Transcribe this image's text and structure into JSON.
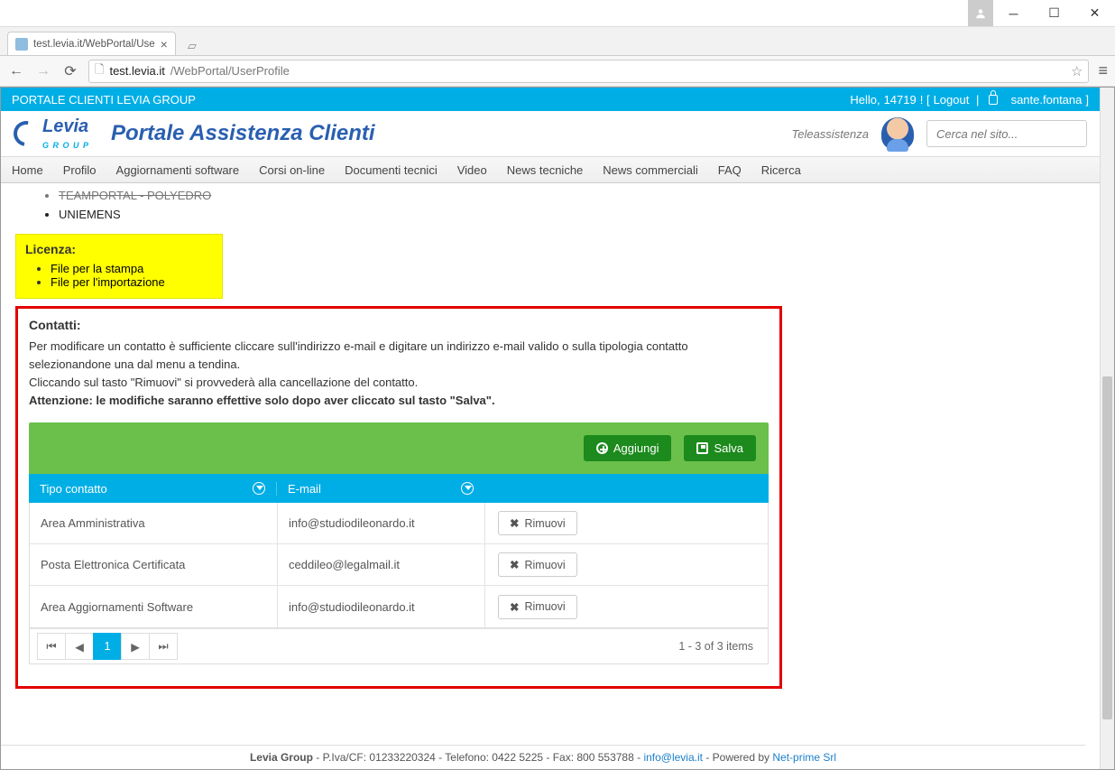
{
  "window": {
    "tab_title": "test.levia.it/WebPortal/Use",
    "url_host": "test.levia.it",
    "url_path": "/WebPortal/UserProfile"
  },
  "topbar": {
    "title": "PORTALE CLIENTI LEVIA GROUP",
    "hello_prefix": "Hello, ",
    "user_id": "14719",
    "logout": "Logout",
    "username": "sante.fontana"
  },
  "header": {
    "logo_name": "Levia",
    "logo_sub": "G R O U P",
    "portal_title": "Portale Assistenza Clienti",
    "tele_label": "Teleassistenza",
    "search_placeholder": "Cerca nel sito..."
  },
  "nav": [
    "Home",
    "Profilo",
    "Aggiornamenti software",
    "Corsi on-line",
    "Documenti tecnici",
    "Video",
    "News tecniche",
    "News commerciali",
    "FAQ",
    "Ricerca"
  ],
  "above_list": {
    "item1": "TEAMPORTAL - POLYEDRO",
    "item2": "UNIEMENS"
  },
  "license_box": {
    "title": "Licenza:",
    "items": [
      "File per la stampa",
      "File per l'importazione"
    ]
  },
  "contacts": {
    "title": "Contatti:",
    "p1": "Per modificare un contatto è sufficiente cliccare sull'indirizzo e-mail e digitare un indirizzo e-mail valido o sulla tipologia contatto selezionandone una dal menu a tendina.",
    "p2": "Cliccando sul tasto \"Rimuovi\" si provvederà alla cancellazione del contatto.",
    "p3": "Attenzione: le modifiche saranno effettive solo dopo aver cliccato sul tasto \"Salva\".",
    "btn_add": "Aggiungi",
    "btn_save": "Salva",
    "col_type": "Tipo contatto",
    "col_email": "E-mail",
    "btn_remove": "Rimuovi",
    "rows": [
      {
        "type": "Area Amministrativa",
        "email": "info@studiodileonardo.it"
      },
      {
        "type": "Posta Elettronica Certificata",
        "email": "ceddileo@legalmail.it"
      },
      {
        "type": "Area Aggiornamenti Software",
        "email": "info@studiodileonardo.it"
      }
    ],
    "page_current": "1",
    "footer_status": "1 - 3 of 3 items"
  },
  "footer": {
    "company": "Levia Group",
    "text1": " - P.Iva/CF: 01233220324 - Telefono: 0422 5225 - Fax: 800 553788 - ",
    "email": "info@levia.it",
    "text2": " - Powered by ",
    "powered": "Net-prime Srl"
  }
}
